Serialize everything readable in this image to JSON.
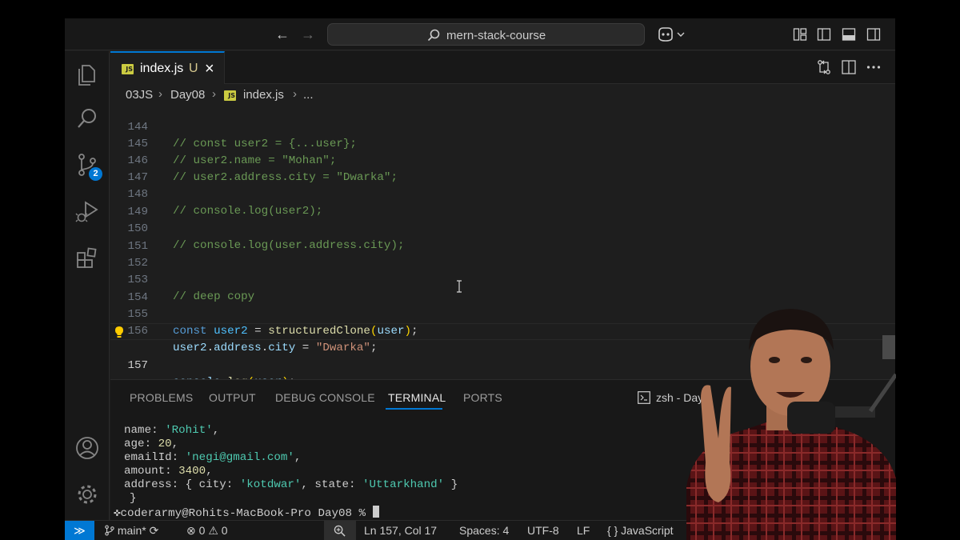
{
  "titlebar": {
    "search_text": "mern-stack-course"
  },
  "activity_bar": {
    "items": [
      "explorer-icon",
      "search-icon",
      "source-control-icon",
      "run-debug-icon",
      "extensions-icon"
    ],
    "source_control_badge": "2",
    "bottom_items": [
      "account-icon",
      "settings-gear-icon"
    ]
  },
  "tab": {
    "file_name": "index.js",
    "modified_flag": "U",
    "icon_label": "JS"
  },
  "breadcrumb": {
    "items": [
      "03JS",
      "Day08",
      "index.js",
      "..."
    ]
  },
  "editor": {
    "lines": [
      {
        "n": "144",
        "text": "// const user2 = {...user};"
      },
      {
        "n": "145",
        "text": "// user2.name = \"Mohan\";"
      },
      {
        "n": "146",
        "text": "// user2.address.city = \"Dwarka\";"
      },
      {
        "n": "147",
        "text": ""
      },
      {
        "n": "148",
        "text": "// console.log(user2);"
      },
      {
        "n": "149",
        "text": ""
      },
      {
        "n": "150",
        "text": "// console.log(user.address.city);"
      },
      {
        "n": "151",
        "text": ""
      },
      {
        "n": "152",
        "text": ""
      },
      {
        "n": "153",
        "text": "// deep copy"
      },
      {
        "n": "154",
        "text": ""
      },
      {
        "n": "155",
        "text": "const user2 = structuredClone(user);"
      },
      {
        "n": "156",
        "text": "user2.address.city = \"Dwarka\";"
      },
      {
        "n": "157",
        "text": "console.log(user);"
      }
    ],
    "tokens": {
      "l155_const": "const",
      "l155_user2": "user2",
      "l155_eq": " = ",
      "l155_fn": "structuredClone",
      "l155_open": "(",
      "l155_user": "user",
      "l155_close": ")",
      "l155_semi": ";",
      "l156_user2": "user2",
      "l156_dot1": ".",
      "l156_address": "address",
      "l156_dot2": ".",
      "l156_city": "city",
      "l156_eq": " = ",
      "l156_str": "\"Dwarka\"",
      "l156_semi": ";",
      "l157_console": "console",
      "l157_dot": ".",
      "l157_log": "log",
      "l157_open": "(",
      "l157_user": "user",
      "l157_close": ")",
      "l157_semi": ";"
    }
  },
  "panel": {
    "tabs": [
      "PROBLEMS",
      "OUTPUT",
      "DEBUG CONSOLE",
      "TERMINAL",
      "PORTS"
    ],
    "active_tab": "TERMINAL",
    "terminal_label": "zsh - Day0",
    "terminal": {
      "name_key": "  name: ",
      "name_val": "'Rohit'",
      "age_key": "  age: ",
      "age_val": "20",
      "email_key": "  emailId: ",
      "email_val": "'negi@gmail.com'",
      "amount_key": "  amount: ",
      "amount_val": "3400",
      "address_key": "  address: { city: ",
      "address_city": "'kotdwar'",
      "address_mid": ", state: ",
      "address_state": "'Uttarkhand'",
      "address_end": " }",
      "close_brace": "}",
      "prompt": "coderarmy@Rohits-MacBook-Pro Day08 % "
    }
  },
  "statusbar": {
    "branch": "main*",
    "errors": "0",
    "warnings": "0",
    "position": "Ln 157, Col 17",
    "spaces": "Spaces: 4",
    "encoding": "UTF-8",
    "eol": "LF",
    "language": "JavaScript",
    "language_braces": "{ }"
  },
  "colors": {
    "accent": "#0078d4",
    "comment": "#6a9955",
    "keyword": "#569cd6",
    "string": "#ce9178",
    "function": "#dcdcaa"
  }
}
